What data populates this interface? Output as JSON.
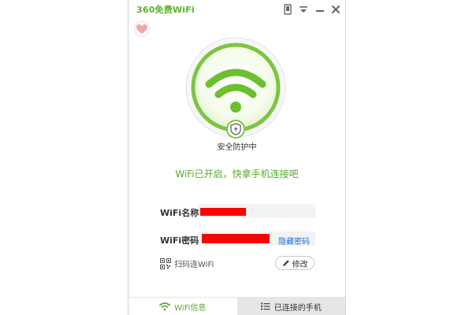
{
  "window": {
    "title": "360免费WiFi",
    "controls": [
      "phone-icon",
      "menu-icon",
      "minimize-icon",
      "close-icon"
    ]
  },
  "heart_icon": "heart-icon",
  "status": {
    "protection_text": "安全防护中",
    "headline": "WiFi已开启，快拿手机连接吧"
  },
  "wifi_name": {
    "label": "WiFi名称:",
    "value_redacted": true
  },
  "wifi_password": {
    "label": "WiFi密码:",
    "value_redacted": true,
    "hide_link": "隐藏密码"
  },
  "actions": {
    "qr_connect": "扫码连WiFi",
    "edit": "修改"
  },
  "tabs": [
    {
      "label": "WiFi信息",
      "icon": "wifi-icon",
      "active": true
    },
    {
      "label": "已连接的手机",
      "icon": "list-icon",
      "active": false
    }
  ],
  "colors": {
    "accent_green": "#5aa92b",
    "link_blue": "#1a73d1",
    "redaction_red": "#ff0000"
  }
}
